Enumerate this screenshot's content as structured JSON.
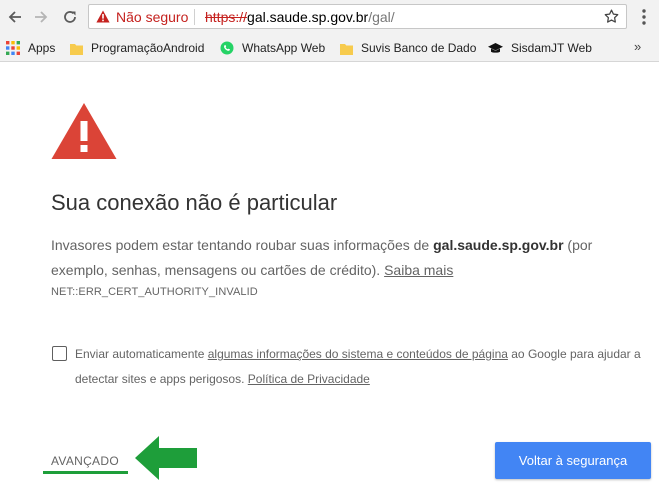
{
  "browser": {
    "address_bar": {
      "security_status": "Não seguro",
      "url_scheme": "https://",
      "url_host": "gal.saude.sp.gov.br",
      "url_path": "/gal/"
    },
    "bookmarks": [
      {
        "label": "Apps",
        "icon": "apps-grid-icon"
      },
      {
        "label": "ProgramaçãoAndroid",
        "icon": "folder-icon"
      },
      {
        "label": "WhatsApp Web",
        "icon": "whatsapp-icon"
      },
      {
        "label": "Suvis Banco de Dado",
        "icon": "folder-icon"
      },
      {
        "label": "SisdamJT Web",
        "icon": "graduation-cap-icon"
      }
    ],
    "bookmarks_overflow": "»"
  },
  "interstitial": {
    "heading": "Sua conexão não é particular",
    "body_prefix": "Invasores podem estar tentando roubar suas informações de ",
    "domain": "gal.saude.sp.gov.br",
    "body_suffix": " (por exemplo, senhas, mensagens ou cartões de crédito). ",
    "learn_more": "Saiba mais",
    "error_code": "NET::ERR_CERT_AUTHORITY_INVALID",
    "opt_in_prefix": "Enviar automaticamente ",
    "opt_in_link": "algumas informações do sistema e conteúdos de página",
    "opt_in_middle": " ao Google para ajudar a detectar sites e apps perigosos. ",
    "privacy_link": "Política de Privacidade",
    "advanced_label": "AVANÇADO",
    "back_button_label": "Voltar à segurança"
  },
  "colors": {
    "warning_red": "#db4437",
    "primary_blue": "#4285f4",
    "annotation_green": "#1e9e3a"
  }
}
